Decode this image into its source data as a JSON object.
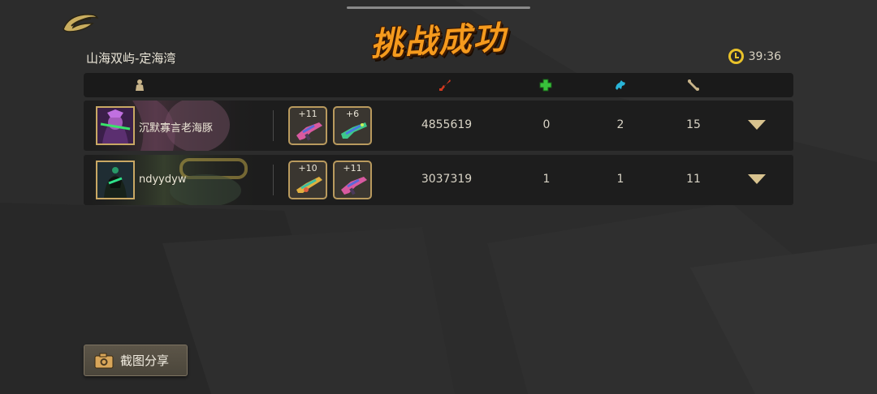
{
  "header": {
    "title": "挑战成功",
    "map_name": "山海双屿-定海湾",
    "timer": "39:36"
  },
  "table": {
    "columns": [
      {
        "icon": "player-icon"
      },
      {
        "icon": "damage-icon"
      },
      {
        "icon": "revive-icon"
      },
      {
        "icon": "downed-icon"
      },
      {
        "icon": "rescue-icon"
      }
    ],
    "rows": [
      {
        "player": "沉默寡言老海豚",
        "weapons": [
          {
            "level": "+11",
            "icon": "pink-rifle-icon"
          },
          {
            "level": "+6",
            "icon": "green-rifle-icon"
          }
        ],
        "damage": "4855619",
        "stat1": "0",
        "stat2": "2",
        "stat3": "15"
      },
      {
        "player": "ndyydyw",
        "weapons": [
          {
            "level": "+10",
            "icon": "golden-rifle-icon"
          },
          {
            "level": "+11",
            "icon": "pink-rifle-icon"
          }
        ],
        "damage": "3037319",
        "stat1": "1",
        "stat2": "1",
        "stat3": "11"
      }
    ]
  },
  "footer": {
    "share_label": "截图分享"
  },
  "colors": {
    "accent_orange": "#f59a1d",
    "damage_red": "#d2381f",
    "heal_green": "#38c23b",
    "downed_cyan": "#29b5d8",
    "bone": "#c8b48a",
    "gold_border": "#c9a864"
  }
}
